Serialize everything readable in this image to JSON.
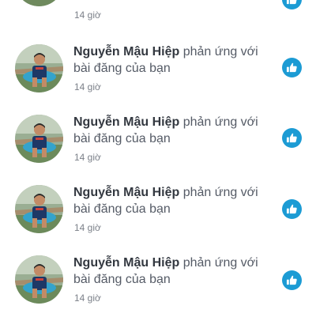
{
  "notifications": [
    {
      "time": "14 giờ"
    },
    {
      "name": "Nguyễn Mậu Hiệp",
      "action": "phản ứng với bài đăng của bạn",
      "time": "14 giờ"
    },
    {
      "name": "Nguyễn Mậu Hiệp",
      "action": "phản ứng với bài đăng của bạn",
      "time": "14 giờ"
    },
    {
      "name": "Nguyễn Mậu Hiệp",
      "action": "phản ứng với bài đăng của bạn",
      "time": "14 giờ"
    },
    {
      "name": "Nguyễn Mậu Hiệp",
      "action": "phản ứng với bài đăng của bạn",
      "time": "14 giờ"
    }
  ],
  "icons": {
    "reaction": "thumbs-up-icon",
    "avatar": "user-photo"
  },
  "colors": {
    "reaction_badge": "#1c9bd4",
    "name_text": "#333840",
    "body_text": "#555b66",
    "time_text": "#7b8089"
  }
}
